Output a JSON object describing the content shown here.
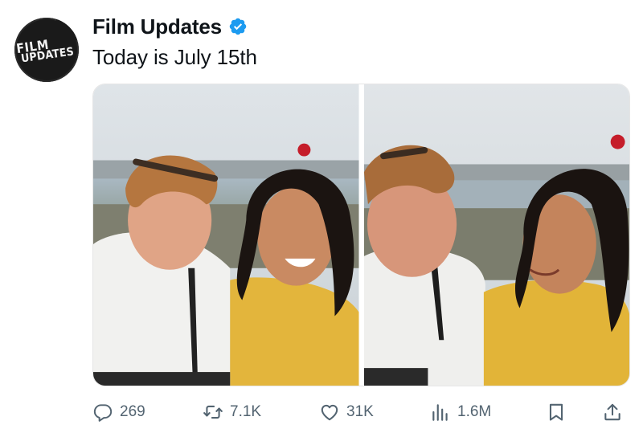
{
  "account": {
    "avatar_line1": "FILM",
    "avatar_line2": "UPDATES",
    "display_name": "Film Updates",
    "verified_icon": "verified-badge-icon",
    "verified_color": "#1d9bf0"
  },
  "tweet": {
    "text": "Today is July 15th"
  },
  "media": {
    "photos": [
      {
        "name": "photo-1"
      },
      {
        "name": "photo-2"
      }
    ]
  },
  "actions": {
    "reply_count": "269",
    "retweet_count": "7.1K",
    "like_count": "31K",
    "view_count": "1.6M",
    "icons": [
      "reply-icon",
      "retweet-icon",
      "like-icon",
      "views-icon",
      "bookmark-icon",
      "share-icon"
    ],
    "icon_color": "#536471"
  }
}
